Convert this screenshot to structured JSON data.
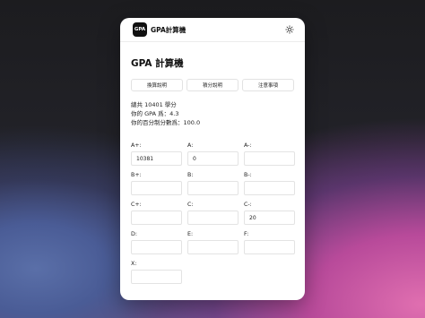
{
  "header": {
    "logo_text": "GPA",
    "brand": "GPA計算機",
    "theme_icon": "sun-icon"
  },
  "main": {
    "title": "GPA 計算機",
    "tabs": [
      {
        "label": "換算說明"
      },
      {
        "label": "積分說明"
      },
      {
        "label": "注意事項"
      }
    ],
    "stats": {
      "total_credits": "總共 10401 學分",
      "gpa": "你的 GPA 爲：4.3",
      "percent": "你的百分制分數爲：100.0"
    },
    "grades": [
      {
        "label": "A+:",
        "value": "10381"
      },
      {
        "label": "A:",
        "value": "0"
      },
      {
        "label": "A-:",
        "value": ""
      },
      {
        "label": "B+:",
        "value": ""
      },
      {
        "label": "B:",
        "value": ""
      },
      {
        "label": "B-:",
        "value": ""
      },
      {
        "label": "C+:",
        "value": ""
      },
      {
        "label": "C:",
        "value": ""
      },
      {
        "label": "C-:",
        "value": "20"
      },
      {
        "label": "D:",
        "value": ""
      },
      {
        "label": "E:",
        "value": ""
      },
      {
        "label": "F:",
        "value": ""
      },
      {
        "label": "X:",
        "value": ""
      }
    ]
  }
}
